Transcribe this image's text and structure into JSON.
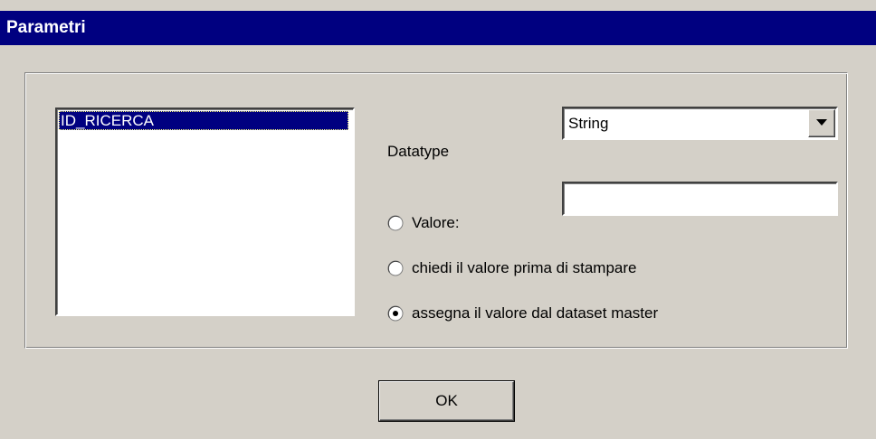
{
  "window": {
    "title": "Parametri"
  },
  "parameters_list": {
    "items": [
      "ID_RICERCA"
    ],
    "selected_index": 0
  },
  "datatype": {
    "label": "Datatype",
    "selected": "String"
  },
  "value_options": [
    {
      "label": "Valore:",
      "checked": false
    },
    {
      "label": "chiedi il valore prima di stampare",
      "checked": false
    },
    {
      "label": "assegna il valore dal dataset master",
      "checked": true
    }
  ],
  "value_input": {
    "value": ""
  },
  "buttons": {
    "ok_label": "OK"
  },
  "colors": {
    "titlebar": "#000080",
    "face": "#d4d0c8",
    "selection": "#000080"
  },
  "icons": {
    "dropdown": "chevron-down-icon"
  }
}
